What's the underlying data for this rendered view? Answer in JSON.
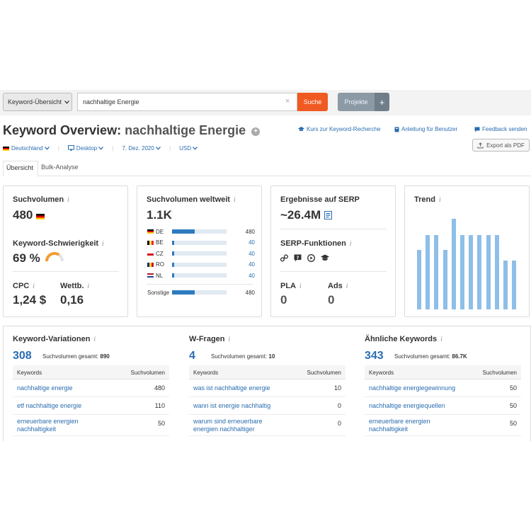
{
  "topbar": {
    "database_dropdown": "Keyword-Übersicht",
    "search_value": "nachhaltige Energie",
    "search_button": "Suche",
    "projects_button": "Projekte",
    "plus_button": "+"
  },
  "header": {
    "title_prefix": "Keyword Overview:",
    "title_keyword": "nachhaltige Energie",
    "links": [
      "Kurs zur Keyword-Recherche",
      "Anleitung für Benutzer",
      "Feedback senden"
    ],
    "export_button": "Export als PDF"
  },
  "filters": {
    "country": "Deutschland",
    "device": "Desktop",
    "date": "7. Dez. 2020",
    "currency": "USD"
  },
  "tabs": [
    "Übersicht",
    "Bulk-Analyse"
  ],
  "widgets": {
    "volume": {
      "title": "Suchvolumen",
      "value": "480",
      "difficulty_title": "Keyword-Schwierigkeit",
      "difficulty_value": "69 %",
      "difficulty_fraction": 0.69,
      "cpc_title": "CPC",
      "cpc_value": "1,24 $",
      "competition_title": "Wettb.",
      "competition_value": "0,16"
    },
    "global": {
      "title": "Suchvolumen weltweit",
      "value": "1.1K",
      "countries": [
        {
          "code": "DE",
          "flag": "de",
          "value": "480",
          "share": 0.42
        },
        {
          "code": "BE",
          "flag": "be",
          "value": "40",
          "share": 0.04
        },
        {
          "code": "CZ",
          "flag": "cz",
          "value": "40",
          "share": 0.04
        },
        {
          "code": "RO",
          "flag": "ro",
          "value": "40",
          "share": 0.04
        },
        {
          "code": "NL",
          "flag": "nl",
          "value": "40",
          "share": 0.04
        }
      ],
      "other_label": "Sonstige",
      "other_value": "480",
      "other_share": 0.42
    },
    "serp": {
      "title": "Ergebnisse auf SERP",
      "value": "~26.4M",
      "features_title": "SERP-Funktionen",
      "feature_icons": [
        "link-icon",
        "faq-icon",
        "video-icon",
        "graduation-cap-icon"
      ],
      "pla_title": "PLA",
      "pla_value": "0",
      "ads_title": "Ads",
      "ads_value": "0"
    },
    "trend": {
      "title": "Trend",
      "values": [
        0.66,
        0.82,
        0.82,
        0.66,
        1.0,
        0.82,
        0.82,
        0.82,
        0.82,
        0.82,
        0.54,
        0.54
      ]
    }
  },
  "info_symbol": "i",
  "bottom": {
    "columns": [
      {
        "title": "Keyword-Variationen",
        "count": "308",
        "total_label": "Suchvolumen gesamt:",
        "total_value": "890",
        "head_keyword": "Keywords",
        "head_volume": "Suchvolumen",
        "rows": [
          {
            "keyword": "nachhaltige energie",
            "volume": "480"
          },
          {
            "keyword": "etf nachhaltige energie",
            "volume": "110"
          },
          {
            "keyword": "erneuerbare energien nachhaltigkeit",
            "volume": "50"
          }
        ]
      },
      {
        "title": "W-Fragen",
        "count": "4",
        "total_label": "Suchvolumen gesamt:",
        "total_value": "10",
        "head_keyword": "Keywords",
        "head_volume": "Suchvolumen",
        "rows": [
          {
            "keyword": "was ist nachhaltige energie",
            "volume": "10"
          },
          {
            "keyword": "wann ist energie nachhaltig",
            "volume": "0"
          },
          {
            "keyword": "warum sind erneuerbare energien nachhaltiger",
            "volume": "0"
          }
        ]
      },
      {
        "title": "Ähnliche Keywords",
        "count": "343",
        "total_label": "Suchvolumen gesamt:",
        "total_value": "86.7K",
        "head_keyword": "Keywords",
        "head_volume": "Suchvolumen",
        "rows": [
          {
            "keyword": "nachhaltige energiegewinnung",
            "volume": "50"
          },
          {
            "keyword": "nachhaltige energiequellen",
            "volume": "50"
          },
          {
            "keyword": "erneuerbare energien nachhaltigkeit",
            "volume": "50"
          }
        ]
      }
    ]
  },
  "colors": {
    "accent_orange": "#f05a22",
    "link_blue": "#2a6db0",
    "bar_blue": "#2d7bbf",
    "trend_blue": "#8dbfe8",
    "gauge_orange": "#f59b2c"
  }
}
